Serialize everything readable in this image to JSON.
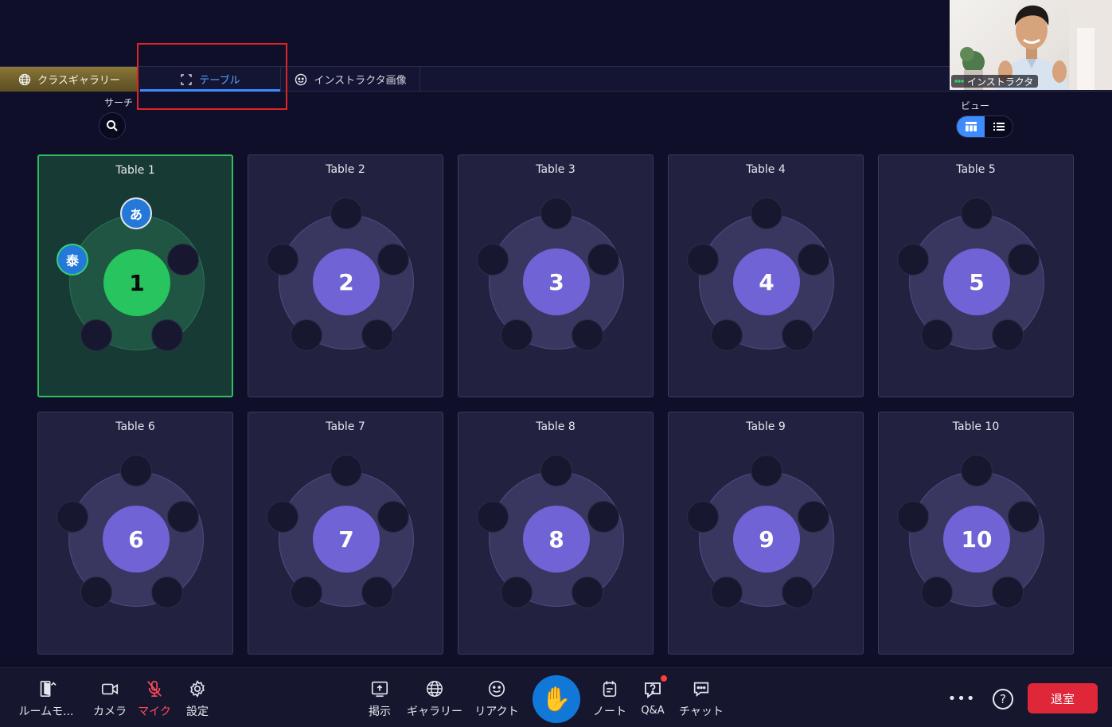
{
  "tabs": {
    "gallery": "クラスギャラリー",
    "table": "テーブル",
    "instructor": "インストラクタ画像"
  },
  "search": {
    "label": "サーチ"
  },
  "view": {
    "label": "ビュー"
  },
  "video": {
    "name": "インストラクタ"
  },
  "tables": [
    {
      "name": "Table 1",
      "number": "1",
      "active": true,
      "seats": [
        "あ",
        "",
        "",
        "",
        "泰"
      ]
    },
    {
      "name": "Table 2",
      "number": "2",
      "active": false,
      "seats": [
        "",
        "",
        "",
        "",
        ""
      ]
    },
    {
      "name": "Table 3",
      "number": "3",
      "active": false,
      "seats": [
        "",
        "",
        "",
        "",
        ""
      ]
    },
    {
      "name": "Table 4",
      "number": "4",
      "active": false,
      "seats": [
        "",
        "",
        "",
        "",
        ""
      ]
    },
    {
      "name": "Table 5",
      "number": "5",
      "active": false,
      "seats": [
        "",
        "",
        "",
        "",
        ""
      ]
    },
    {
      "name": "Table 6",
      "number": "6",
      "active": false,
      "seats": [
        "",
        "",
        "",
        "",
        ""
      ]
    },
    {
      "name": "Table 7",
      "number": "7",
      "active": false,
      "seats": [
        "",
        "",
        "",
        "",
        ""
      ]
    },
    {
      "name": "Table 8",
      "number": "8",
      "active": false,
      "seats": [
        "",
        "",
        "",
        "",
        ""
      ]
    },
    {
      "name": "Table 9",
      "number": "9",
      "active": false,
      "seats": [
        "",
        "",
        "",
        "",
        ""
      ]
    },
    {
      "name": "Table 10",
      "number": "10",
      "active": false,
      "seats": [
        "",
        "",
        "",
        "",
        ""
      ]
    }
  ],
  "toolbar": {
    "room_mode": "ルームモ...",
    "camera": "カメラ",
    "mic": "マイク",
    "settings": "設定",
    "share": "掲示",
    "gallery": "ギャラリー",
    "react": "リアクト",
    "notes": "ノート",
    "qa": "Q&A",
    "chat": "チャット",
    "leave": "退室"
  },
  "colors": {
    "accent": "#3d8bff",
    "active_table": "#27c45f",
    "table_center": "#6f63d6",
    "leave": "#e0273a",
    "mic_muted": "#ff4b5a"
  }
}
